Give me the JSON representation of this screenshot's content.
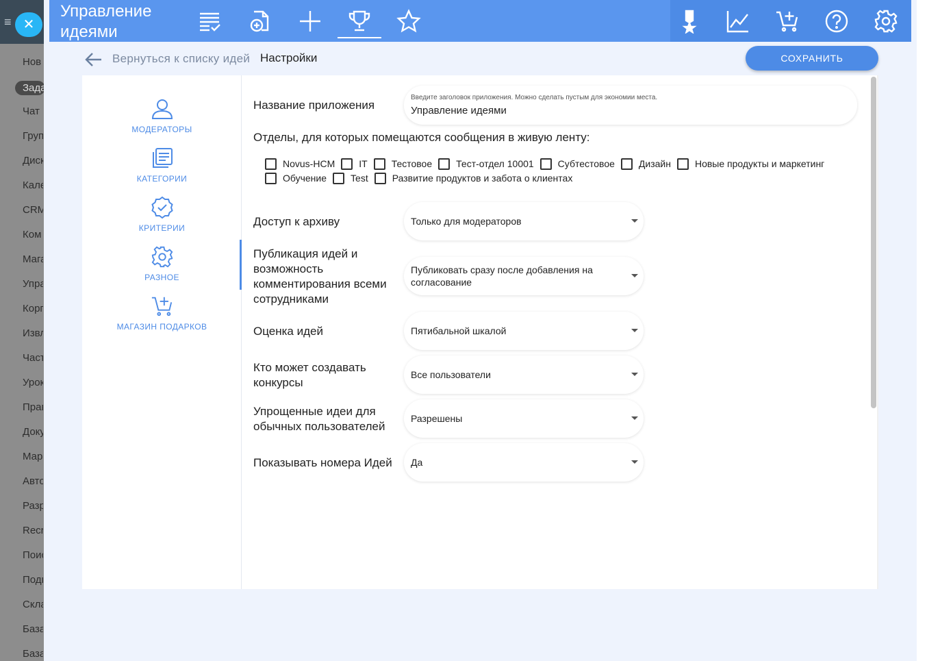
{
  "background_sidebar": {
    "items": [
      "Нов",
      "Зада",
      "Чат",
      "Груп",
      "Диск",
      "Кале",
      "CRM",
      "Ком",
      "Мага",
      "Упра",
      "Корп",
      "Извл",
      "Част",
      "Урок",
      "Прав",
      "Доку",
      "Мар",
      "Авто",
      "Разр",
      "Recr",
      "Поис",
      "Подп",
      "Скла",
      "База",
      "База"
    ],
    "active_index": 1
  },
  "close_button": {
    "icon": "close-icon",
    "glyph": "✕"
  },
  "header": {
    "app_title": "Управление идеями",
    "icons_left": [
      "ideas-list-icon",
      "add-document-icon",
      "plus-icon",
      "trophy-icon",
      "star-icon"
    ],
    "active_icon": "trophy-icon",
    "icons_right": [
      "medal-icon",
      "analytics-icon",
      "cart-add-icon",
      "help-icon",
      "gear-icon"
    ],
    "colors": {
      "bar": "#5a96ee",
      "bar_right": "#4d8be6"
    }
  },
  "subheader": {
    "back_label": "Вернуться к списку идей",
    "page_title": "Настройки",
    "save_label": "СОХРАНИТЬ"
  },
  "nav": {
    "items": [
      {
        "label": "МОДЕРАТОРЫ",
        "icon": "user-icon"
      },
      {
        "label": "КАТЕГОРИИ",
        "icon": "categories-icon"
      },
      {
        "label": "КРИТЕРИИ",
        "icon": "badge-check-icon"
      },
      {
        "label": "РАЗНОЕ",
        "icon": "gear-icon"
      },
      {
        "label": "МАГАЗИН ПОДАРКОВ",
        "icon": "cart-add-icon"
      }
    ],
    "active_index": 3
  },
  "settings": {
    "app_name": {
      "label": "Название приложения",
      "placeholder": "Введите заголовок приложения. Можно сделать пустым для экономии места.",
      "value": "Управление идеями"
    },
    "departments": {
      "label": "Отделы, для которых помещаются сообщения в живую ленту:",
      "row1": [
        "Novus-HCM",
        "IT",
        "Тестовое",
        "Тест-отдел 10001",
        "Субтестовое",
        "Дизайн",
        "Новые продукты и маркетинг"
      ],
      "row2": [
        "Обучение",
        "Test",
        "Развитие продуктов и забота о клиентах"
      ]
    },
    "archive_access": {
      "label": "Доступ к архиву",
      "value": "Только для модераторов"
    },
    "publication": {
      "label": "Публикация идей и возможность комментирования всеми сотрудниками",
      "value": "Публиковать сразу после добавления на согласование"
    },
    "rating": {
      "label": "Оценка идей",
      "value": "Пятибальной шкалой"
    },
    "contests": {
      "label": "Кто может создавать конкурсы",
      "value": "Все пользователи"
    },
    "simple_ideas": {
      "label": "Упрощенные идеи для обычных пользователей",
      "value": "Разрешены"
    },
    "show_numbers": {
      "label": "Показывать номера Идей",
      "value": "Да"
    }
  }
}
